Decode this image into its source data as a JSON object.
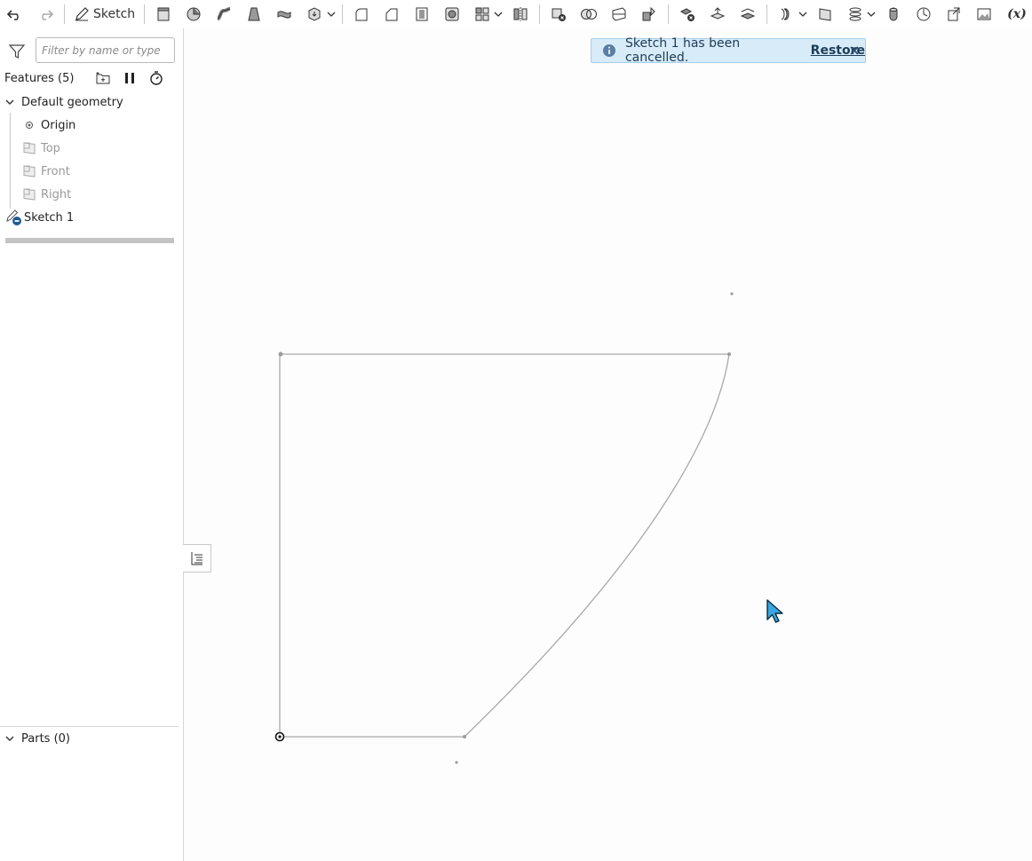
{
  "toolbar": {
    "sketch_label": "Sketch",
    "fx_label": "(x)",
    "icons": [
      "undo-icon",
      "redo-icon",
      "sketch-icon",
      "extrude-icon",
      "revolve-icon",
      "sweep-icon",
      "loft-icon",
      "thicken-icon",
      "enclose-icon",
      "fillet-icon",
      "chamfer-icon",
      "draft-icon",
      "shell-icon",
      "pattern-icon",
      "mirror-icon",
      "delete-part-icon",
      "boolean-icon",
      "split-icon",
      "transform-icon",
      "delete-face-icon",
      "move-face-icon",
      "replace-face-icon",
      "offset-surface-icon",
      "plane-icon",
      "helix-icon",
      "mate-connector-icon",
      "measure-icon",
      "import-icon",
      "image-icon",
      "variable-icon"
    ]
  },
  "panel": {
    "filter_placeholder": "Filter by name or type",
    "features_title": "Features (5)",
    "tree": {
      "default_geometry": "Default geometry",
      "origin": "Origin",
      "top": "Top",
      "front": "Front",
      "right": "Right",
      "sketch": "Sketch 1"
    },
    "parts_title": "Parts (0)"
  },
  "notice": {
    "message": "Sketch 1 has been cancelled.",
    "action": "Restore"
  },
  "colors": {
    "accent": "#1f5a96",
    "notice_bg": "#d8ebf8",
    "sketch_line": "#a9a9a9"
  }
}
